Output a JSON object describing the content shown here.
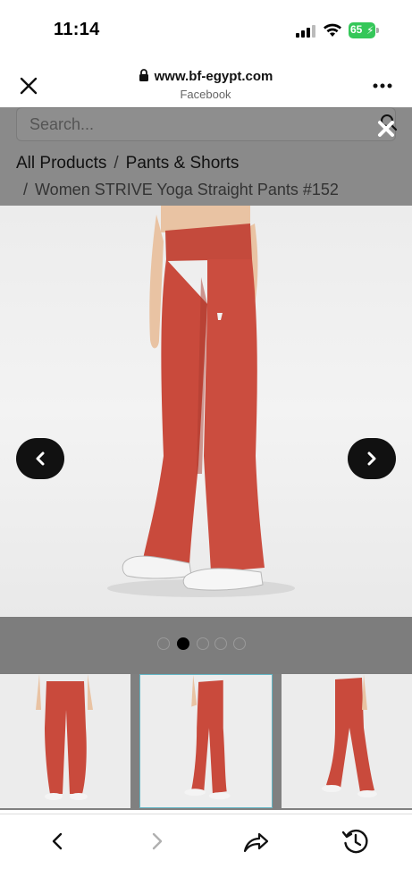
{
  "status_bar": {
    "time": "11:14",
    "battery": "65"
  },
  "browser": {
    "url": "www.bf-egypt.com",
    "source": "Facebook"
  },
  "search": {
    "placeholder": "Search..."
  },
  "breadcrumb": {
    "items": [
      "All Products",
      "Pants & Shorts"
    ],
    "current": "Women STRIVE Yoga Straight Pants #152",
    "separator": "/"
  },
  "gallery": {
    "total_images": 5,
    "active_index": 1
  },
  "colors": {
    "pants": "#c94a3c",
    "overlay": "#808080",
    "battery": "#35c759",
    "thumb_selected_border": "#63b6c5"
  },
  "icons": {
    "close_tab": "close-icon",
    "more": "more-icon",
    "prev": "chevron-left-icon",
    "next": "chevron-right-icon",
    "share": "share-icon",
    "history": "history-icon"
  }
}
